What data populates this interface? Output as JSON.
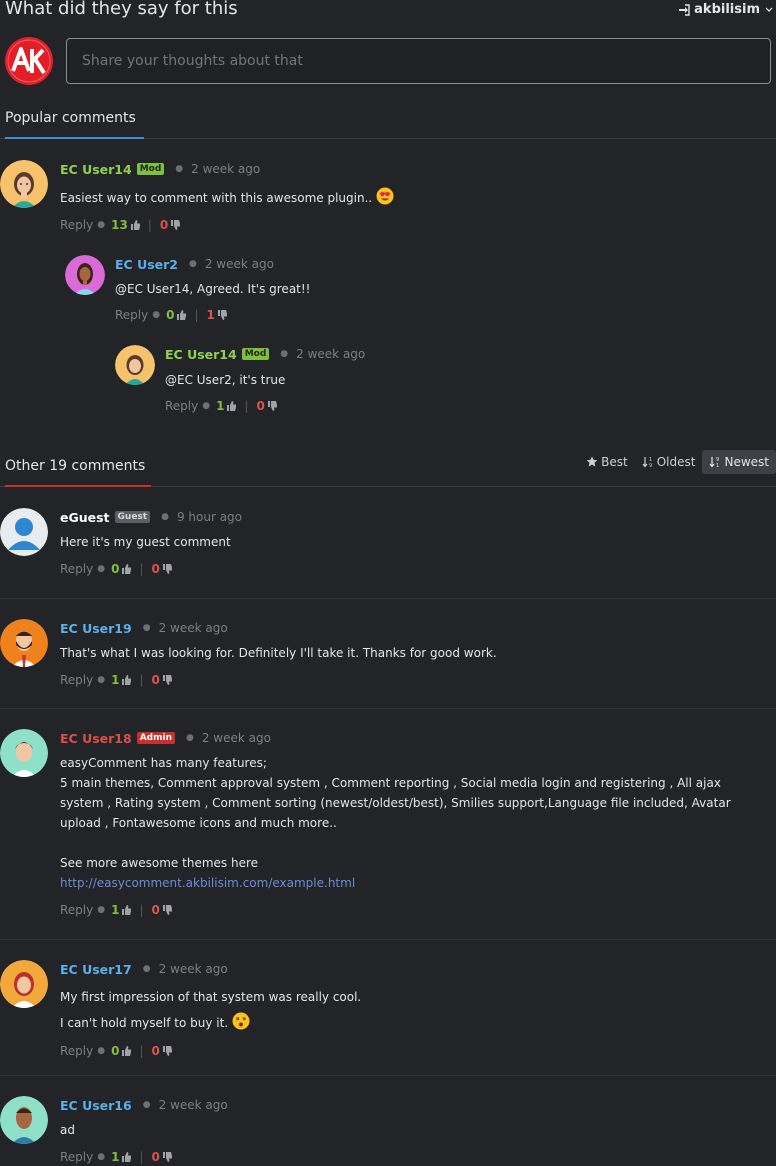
{
  "header": {
    "title": "What did they say for this",
    "user": "akbilisim"
  },
  "composer": {
    "placeholder": "Share your thoughts about that",
    "logo_text": "AK"
  },
  "popular": {
    "label": "Popular comments",
    "comments": [
      {
        "name": "EC User14",
        "badge": "Mod",
        "time": "2 week ago",
        "text": "Easiest way to comment with this awesome plugin..",
        "emoji": "heart-eyes-emoji",
        "reply": "Reply",
        "up": "13",
        "down": "0"
      },
      {
        "name": "EC User2",
        "time": "2 week ago",
        "text": "@EC User14, Agreed. It's great!!",
        "reply": "Reply",
        "up": "0",
        "down": "1"
      },
      {
        "name": "EC User14",
        "badge": "Mod",
        "time": "2 week ago",
        "text": "@EC User2, it's true",
        "reply": "Reply",
        "up": "1",
        "down": "0"
      }
    ]
  },
  "other": {
    "label": "Other 19 comments",
    "sort": {
      "best": "Best",
      "oldest": "Oldest",
      "newest": "Newest",
      "active": "Newest"
    },
    "comments": [
      {
        "name": "eGuest",
        "badge": "Guest",
        "time": "9 hour ago",
        "text": "Here it's my guest comment",
        "reply": "Reply",
        "up": "0",
        "down": "0"
      },
      {
        "name": "EC User19",
        "time": "2 week ago",
        "text": "That's what I was looking for. Definitely I'll take it. Thanks for good work.",
        "reply": "Reply",
        "up": "1",
        "down": "0"
      },
      {
        "name": "EC User18",
        "badge": "Admin",
        "time": "2 week ago",
        "lines": [
          "easyComment has many features;",
          "5 main themes, Comment approval system , Comment reporting , Social media login and registering , All ajax system , Rating system , Comment sorting (newest/oldest/best), Smilies support,Language file included, Avatar upload , Fontawesome icons and much more..",
          "See more awesome themes here"
        ],
        "link": "http://easycomment.akbilisim.com/example.html",
        "reply": "Reply",
        "up": "1",
        "down": "0"
      },
      {
        "name": "EC User17",
        "time": "2 week ago",
        "lines": [
          "My first impression of that system was really cool.",
          "I can't hold myself to buy it."
        ],
        "emoji": "dizzy-face-emoji",
        "reply": "Reply",
        "up": "0",
        "down": "0"
      },
      {
        "name": "EC User16",
        "time": "2 week ago",
        "text": "ad",
        "reply": "Reply",
        "up": "1",
        "down": "0"
      }
    ]
  },
  "colors": {
    "mod_name": "#8fd14f",
    "user_name": "#5ab0e8",
    "admin_name": "#e04b4b",
    "guest_name": "#ffffff",
    "accent_popular": "#3a8fd1",
    "accent_other": "#c9302c"
  }
}
